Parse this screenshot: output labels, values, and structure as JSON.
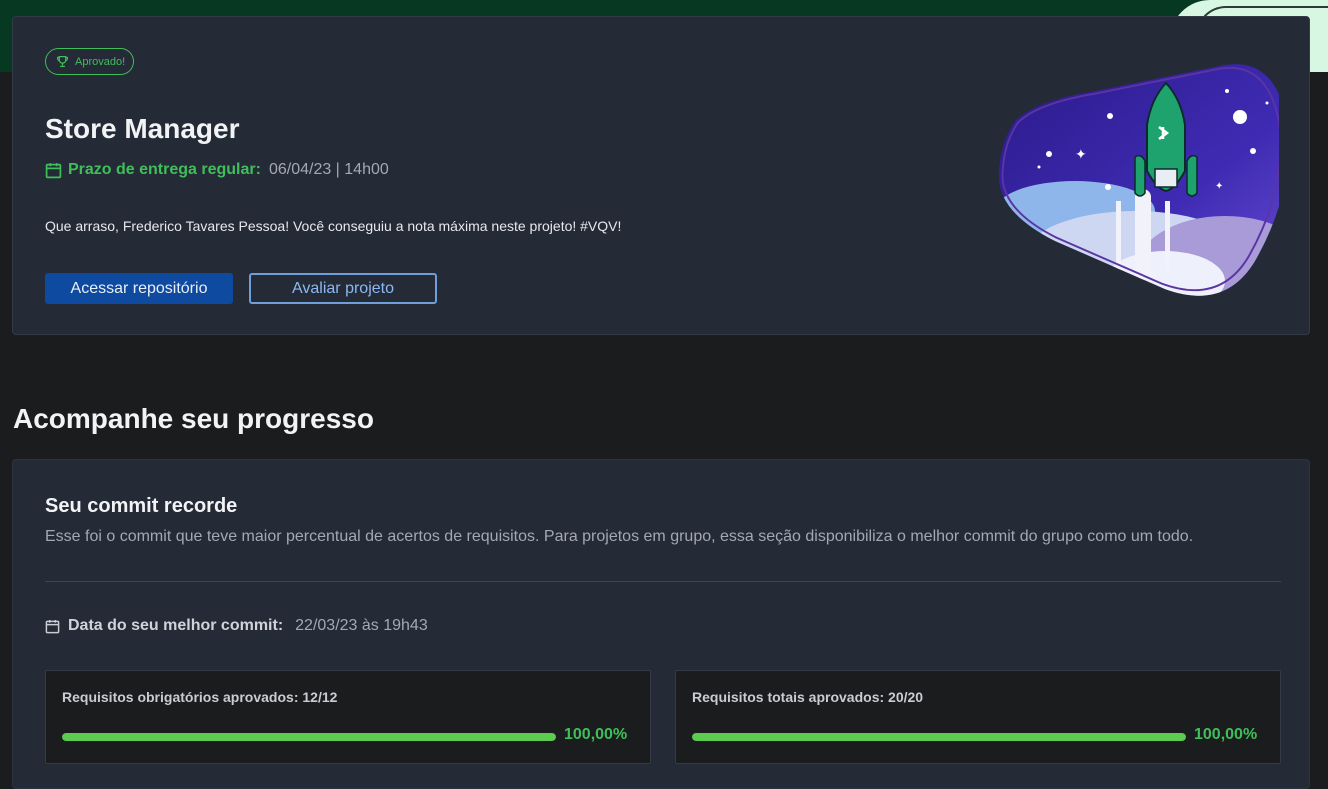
{
  "project": {
    "badge": "Aprovado!",
    "title": "Store Manager",
    "deadline_label": "Prazo de entrega regular:",
    "deadline_value": "06/04/23 | 14h00",
    "message": "Que arraso, Frederico Tavares Pessoa! Você conseguiu a nota máxima neste projeto! #VQV!",
    "repo_button": "Acessar repositório",
    "rate_button": "Avaliar projeto"
  },
  "progress": {
    "section_title": "Acompanhe seu progresso",
    "commit_title": "Seu commit recorde",
    "commit_description": "Esse foi o commit que teve maior percentual de acertos de requisitos. Para projetos em grupo, essa seção disponibiliza o melhor commit do grupo como um todo.",
    "best_commit_label": "Data do seu melhor commit:",
    "best_commit_value": "22/03/23 às 19h43",
    "mandatory": {
      "label": "Requisitos obrigatórios aprovados: 12/12",
      "percent_text": "100,00%",
      "fraction": 1.0
    },
    "total": {
      "label": "Requisitos totais aprovados: 20/20",
      "percent_text": "100,00%",
      "fraction": 1.0
    }
  },
  "colors": {
    "accent_green": "#3fbf5a",
    "primary_blue": "#0d4aa0",
    "card_bg": "#242a36",
    "header_green": "#073822"
  },
  "icons": {
    "badge": "trophy-icon",
    "deadline": "calendar-icon",
    "best_commit": "calendar-icon"
  }
}
